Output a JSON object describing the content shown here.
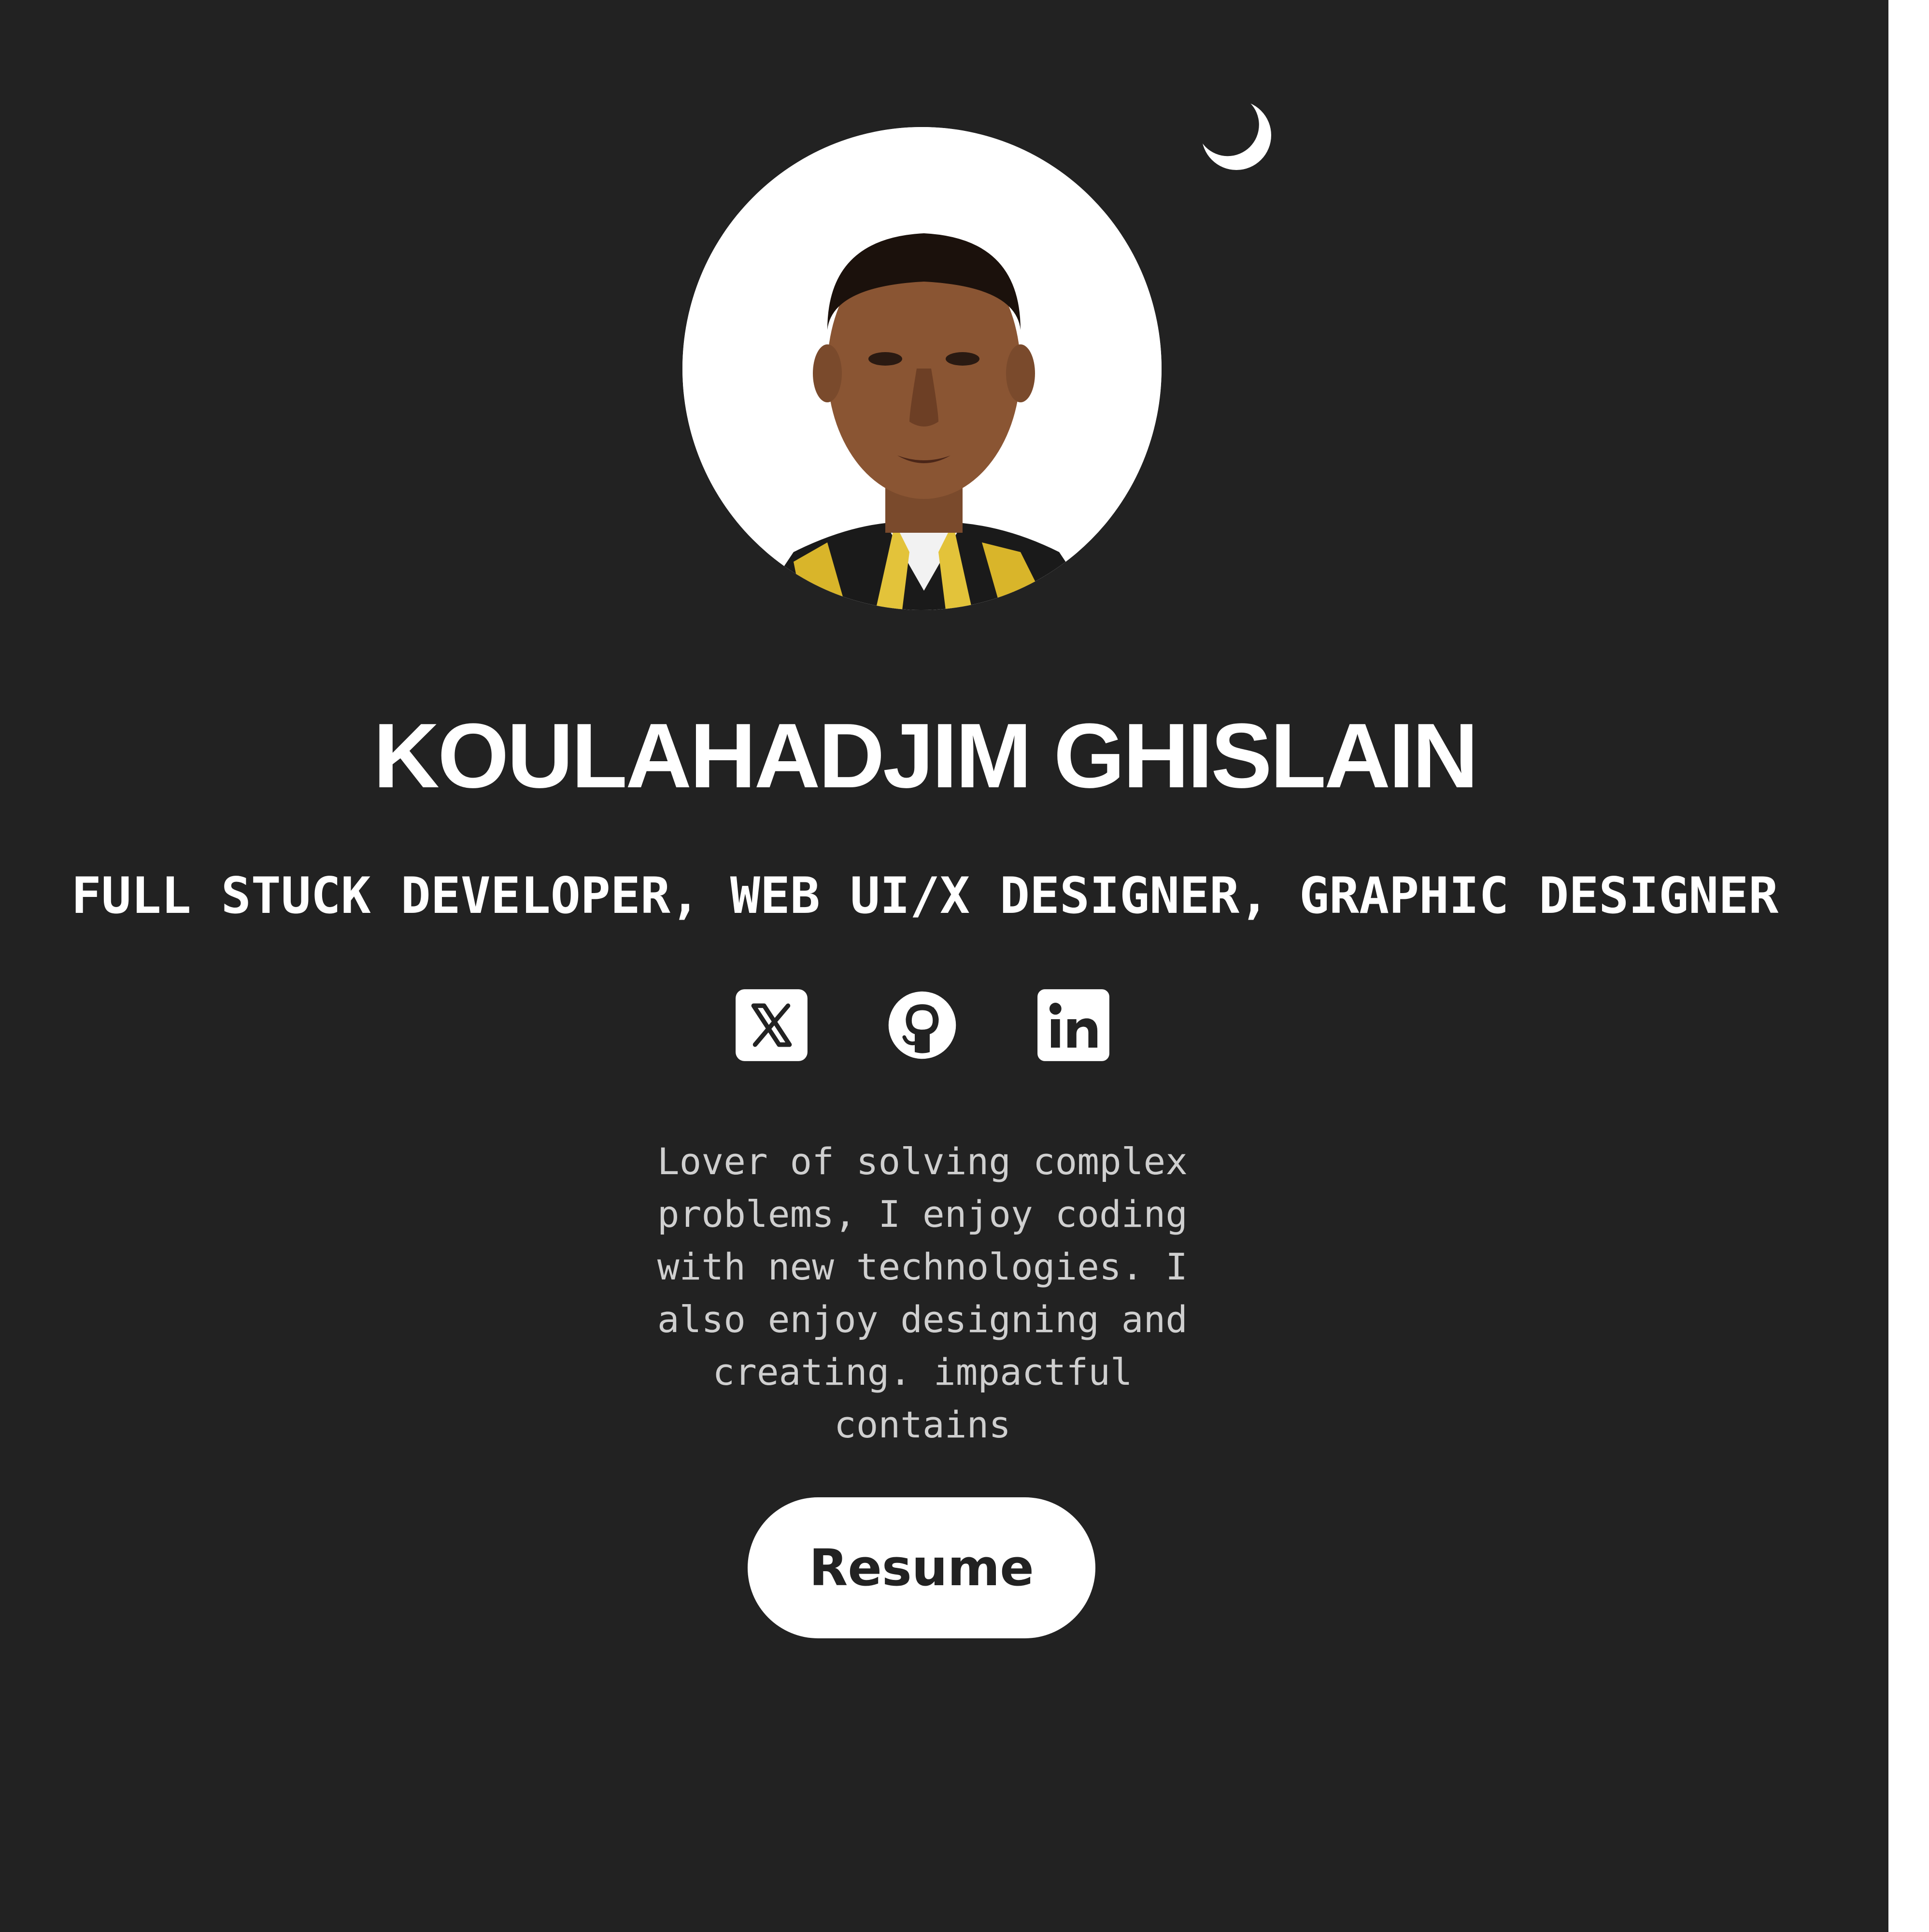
{
  "profile": {
    "name": "KOULAHADJIM GHISLAIN",
    "title": "FULL STUCK DEVELOPER, WEB UI/X DESIGNER, GRAPHIC DESIGNER",
    "bio": "Lover of solving complex problems, I enjoy coding with new technologies. I also enjoy designing and creating. impactful contains",
    "avatar_icon": "profile-photo"
  },
  "theme_toggle": {
    "icon": "moon-icon"
  },
  "socials": [
    {
      "name": "X",
      "icon": "x-icon"
    },
    {
      "name": "GitHub",
      "icon": "github-icon"
    },
    {
      "name": "LinkedIn",
      "icon": "linkedin-icon"
    }
  ],
  "actions": {
    "resume_label": "Resume"
  },
  "colors": {
    "background": "#222222",
    "text": "#ffffff",
    "bio_text": "#cfcfcf",
    "button_bg": "#ffffff",
    "button_text": "#222222"
  }
}
